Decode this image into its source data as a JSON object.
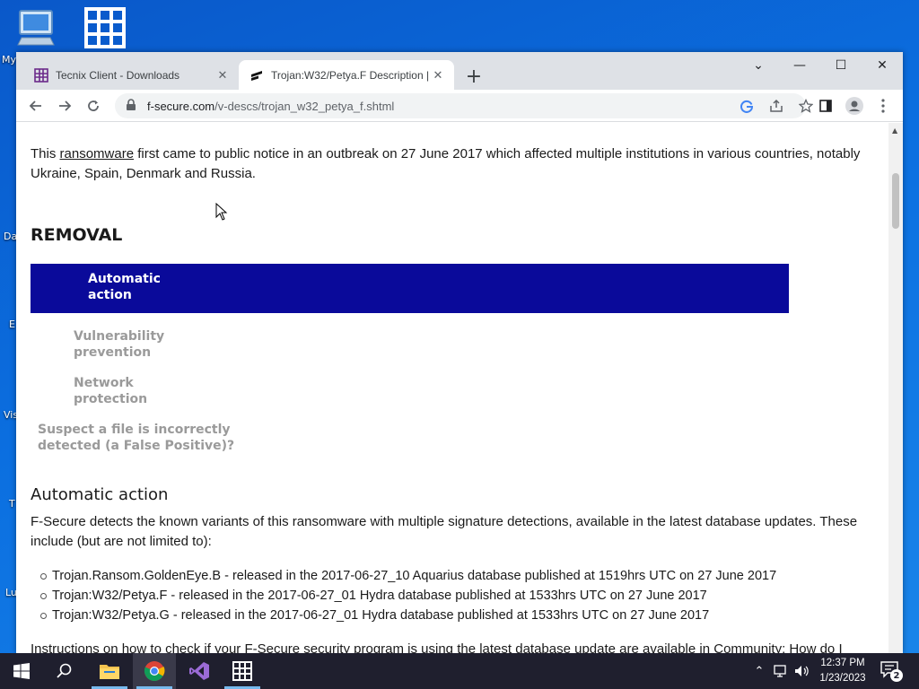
{
  "desktop": {
    "icons": [
      {
        "label": "My"
      },
      {
        "label": "Da"
      },
      {
        "label": "E"
      },
      {
        "label": "Vis"
      },
      {
        "label": "T"
      },
      {
        "label": "Lu"
      }
    ]
  },
  "browser": {
    "tabs": [
      {
        "title": "Tecnix Client - Downloads",
        "active": false
      },
      {
        "title": "Trojan:W32/Petya.F Description |",
        "active": true
      }
    ],
    "new_tab": "+",
    "controls": {
      "dropdown": "⌄",
      "minimize": "—",
      "maximize": "☐",
      "close": "✕"
    },
    "url_host": "f-secure.com",
    "url_path": "/v-descs/trojan_w32_petya_f.shtml"
  },
  "page": {
    "intro_pre": "This ",
    "intro_link": "ransomware",
    "intro_post": " first came to public notice in an outbreak on 27 June 2017 which affected multiple institutions in various countries, notably Ukraine, Spain, Denmark and Russia.",
    "removal_heading": "REMOVAL",
    "removal_tabs": [
      {
        "label": "Automatic action",
        "active": true
      },
      {
        "label": "Vulnerability prevention",
        "active": false
      },
      {
        "label": "Network protection",
        "active": false
      },
      {
        "label": "Suspect a file is incorrectly detected (a False Positive)?",
        "active": false
      }
    ],
    "auto_heading": "Automatic action",
    "auto_desc": "F-Secure detects the known variants of this ransomware with multiple signature detections, available in the latest database updates. These include (but are not limited to):",
    "variants": [
      "Trojan.Ransom.GoldenEye.B - released in the 2017-06-27_10 Aquarius database published at 1519hrs UTC on 27 June 2017",
      "Trojan:W32/Petya.F - released in the 2017-06-27_01 Hydra database published at 1533hrs UTC on 27 June 2017",
      "Trojan:W32/Petya.G - released in the 2017-06-27_01 Hydra database published at 1533hrs UTC on 27 June 2017"
    ],
    "instructions": "Instructions on how to check if your F-Secure security program is using the latest database update are available in Community: How do I"
  },
  "taskbar": {
    "time": "12:37 PM",
    "date": "1/23/2023",
    "notification_count": "2"
  },
  "colors": {
    "active_tab_bg": "#0a0a9a",
    "inactive_tab_text": "#9a9a9a",
    "taskbar_bg": "#1f1f2e"
  }
}
